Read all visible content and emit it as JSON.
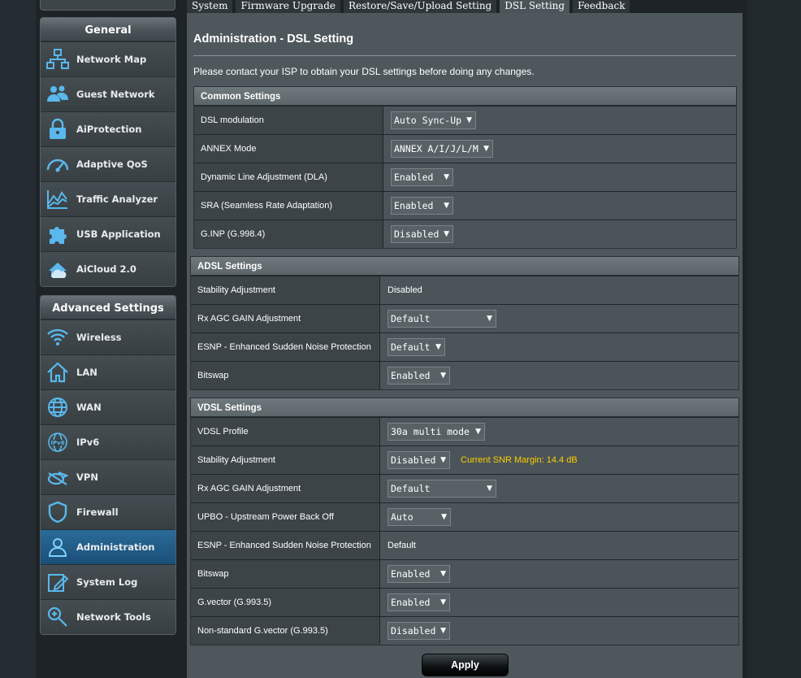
{
  "sidebar": {
    "general": {
      "title": "General",
      "items": [
        {
          "label": "Network Map",
          "icon": "network-map-icon"
        },
        {
          "label": "Guest Network",
          "icon": "guest-network-icon"
        },
        {
          "label": "AiProtection",
          "icon": "aiprotection-lock-icon"
        },
        {
          "label": "Adaptive QoS",
          "icon": "qos-gauge-icon"
        },
        {
          "label": "Traffic Analyzer",
          "icon": "traffic-chart-icon"
        },
        {
          "label": "USB Application",
          "icon": "usb-puzzle-icon"
        },
        {
          "label": "AiCloud 2.0",
          "icon": "aicloud-icon"
        }
      ]
    },
    "advanced": {
      "title": "Advanced Settings",
      "items": [
        {
          "label": "Wireless",
          "icon": "wifi-icon"
        },
        {
          "label": "LAN",
          "icon": "home-icon"
        },
        {
          "label": "WAN",
          "icon": "globe-icon"
        },
        {
          "label": "IPv6",
          "icon": "ipv6-globe-icon"
        },
        {
          "label": "VPN",
          "icon": "vpn-icon"
        },
        {
          "label": "Firewall",
          "icon": "shield-icon"
        },
        {
          "label": "Administration",
          "icon": "admin-user-icon"
        },
        {
          "label": "System Log",
          "icon": "system-log-icon"
        },
        {
          "label": "Network Tools",
          "icon": "network-tools-icon"
        }
      ]
    }
  },
  "tabs": [
    {
      "label": "System"
    },
    {
      "label": "Firmware Upgrade"
    },
    {
      "label": "Restore/Save/Upload Setting"
    },
    {
      "label": "DSL Setting"
    },
    {
      "label": "Feedback"
    }
  ],
  "main": {
    "title": "Administration - DSL Setting",
    "notice": "Please contact your ISP to obtain your DSL settings before doing any changes."
  },
  "common": {
    "title": "Common Settings",
    "rows": [
      {
        "label": "DSL modulation",
        "value": "Auto Sync-Up"
      },
      {
        "label": "ANNEX Mode",
        "value": "ANNEX A/I/J/L/M"
      },
      {
        "label": "Dynamic Line Adjustment (DLA)",
        "value": "Enabled"
      },
      {
        "label": "SRA (Seamless Rate Adaptation)",
        "value": "Enabled"
      },
      {
        "label": "G.INP (G.998.4)",
        "value": "Disabled"
      }
    ]
  },
  "adsl": {
    "title": "ADSL Settings",
    "rows": [
      {
        "label": "Stability Adjustment",
        "value": "Disabled"
      },
      {
        "label": "Rx AGC GAIN Adjustment",
        "value": "Default"
      },
      {
        "label": "ESNP - Enhanced Sudden Noise Protection",
        "value": "Default"
      },
      {
        "label": "Bitswap",
        "value": "Enabled"
      }
    ]
  },
  "vdsl": {
    "title": "VDSL Settings",
    "rows": [
      {
        "label": "VDSL Profile",
        "value": "30a multi mode"
      },
      {
        "label": "Stability Adjustment",
        "value": "Disabled"
      },
      {
        "label": "Rx AGC GAIN Adjustment",
        "value": "Default"
      },
      {
        "label": "UPBO - Upstream Power Back Off",
        "value": "Auto"
      },
      {
        "label": "ESNP - Enhanced Sudden Noise Protection",
        "value": "Default"
      },
      {
        "label": "Bitswap",
        "value": "Enabled"
      },
      {
        "label": "G.vector (G.993.5)",
        "value": "Enabled"
      },
      {
        "label": "Non-standard G.vector (G.993.5)",
        "value": "Disabled"
      }
    ],
    "snr_note": "Current SNR Margin: 14.4 dB"
  },
  "apply_label": "Apply",
  "dropdown_arrow": "▼",
  "colors": {
    "accent_blue": "#1a4f78",
    "snr_yellow": "#ffcc00",
    "panel": "#4e585c"
  }
}
